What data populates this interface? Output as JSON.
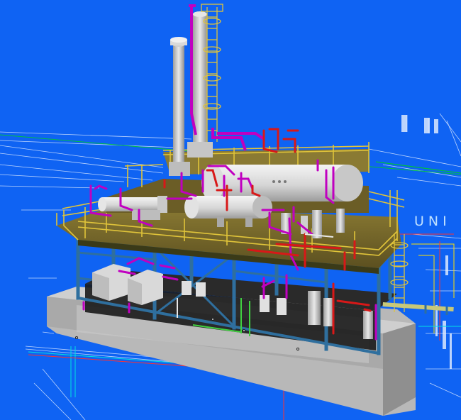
{
  "viewport": {
    "background_color": "#0f63f3",
    "drawing_text": "UNI",
    "colors": {
      "steel": "#2f6f9e",
      "deck": "#7a6a2a",
      "handrail": "#e0c43a",
      "pipe_magenta": "#c000c0",
      "pipe_red": "#d81818",
      "vessel": "#d9d9d9",
      "base_slab": "#bdbdbd",
      "drawing_lines": "#e6f0ff",
      "grid_green": "#00c040"
    },
    "objects": [
      "process-skid",
      "stack",
      "column-with-ladder",
      "horizontal-drum-large",
      "horizontal-drum-small",
      "horizontal-exchanger",
      "pumps",
      "base-slab"
    ]
  }
}
